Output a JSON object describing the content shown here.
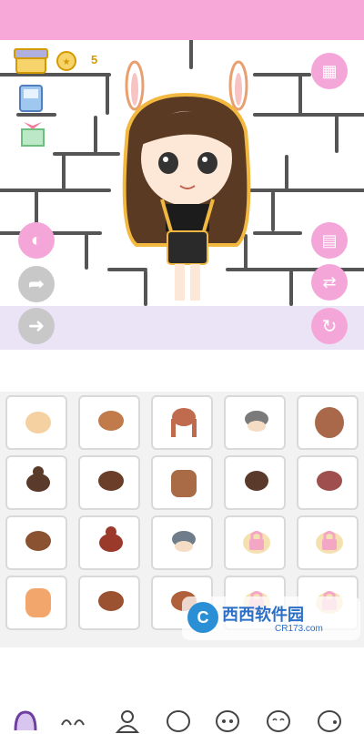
{
  "coins": {
    "count": "5"
  },
  "colors": {
    "accent_pink": "#f5a6d9",
    "floor": "#ebe4f7",
    "topbar": "#f7a8d8"
  },
  "tabs": [
    "hair-tab",
    "eyebrows-tab",
    "body-tab",
    "face-tab",
    "eyes-tab",
    "expression-tab",
    "ear-tab"
  ],
  "grid": {
    "rows": [
      [
        "hair-short-1",
        "hair-short-2",
        "hair-braids",
        "hair-short-grey",
        "hair-long-curly"
      ],
      [
        "hair-bun",
        "hair-short-3",
        "hair-long-straight",
        "hair-bob",
        "hair-short-pink"
      ],
      [
        "hair-side-part",
        "hair-top-knot",
        "hair-short-grey-2",
        "hair-locked-1",
        "hair-locked-2"
      ],
      [
        "hair-long-orange",
        "hair-short-4",
        "hair-short-5",
        "hair-locked-3",
        "hair-locked-4"
      ]
    ]
  },
  "watermark": {
    "brand": "西西软件园",
    "url": "CR173.com"
  }
}
